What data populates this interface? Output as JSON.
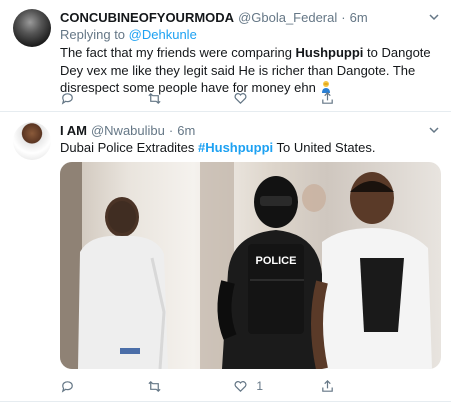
{
  "tweets": [
    {
      "name": "CONCUBINEOFYOURMODA",
      "handle": "@Gbola_Federal",
      "dot": "·",
      "time": "6m",
      "replying_prefix": "Replying to",
      "replying_to": "@Dehkunle",
      "text_parts": {
        "p1": "The fact that my friends were comparing ",
        "b1": "Hushpuppi",
        "p2": " to Dangote Dey vex me like they legit said He is richer than Dangote. The disrespect some people have for money ehn"
      },
      "emoji_icon": "person-facepalming-icon",
      "actions": {
        "reply": "",
        "retweet": "",
        "like": "",
        "share": ""
      }
    },
    {
      "name": "I AM",
      "handle": "@Nwabulibu",
      "dot": "·",
      "time": "6m",
      "text_parts": {
        "p1": "Dubai Police Extradites ",
        "hashtag": "#Hushpuppi",
        "p2": " To United States."
      },
      "media": {
        "vest_text": "POLICE"
      },
      "actions": {
        "reply": "",
        "retweet": "",
        "like": "1",
        "share": ""
      }
    }
  ],
  "colors": {
    "accent": "#1da1f2",
    "secondary_text": "#657786",
    "border": "#e6ecf0"
  }
}
